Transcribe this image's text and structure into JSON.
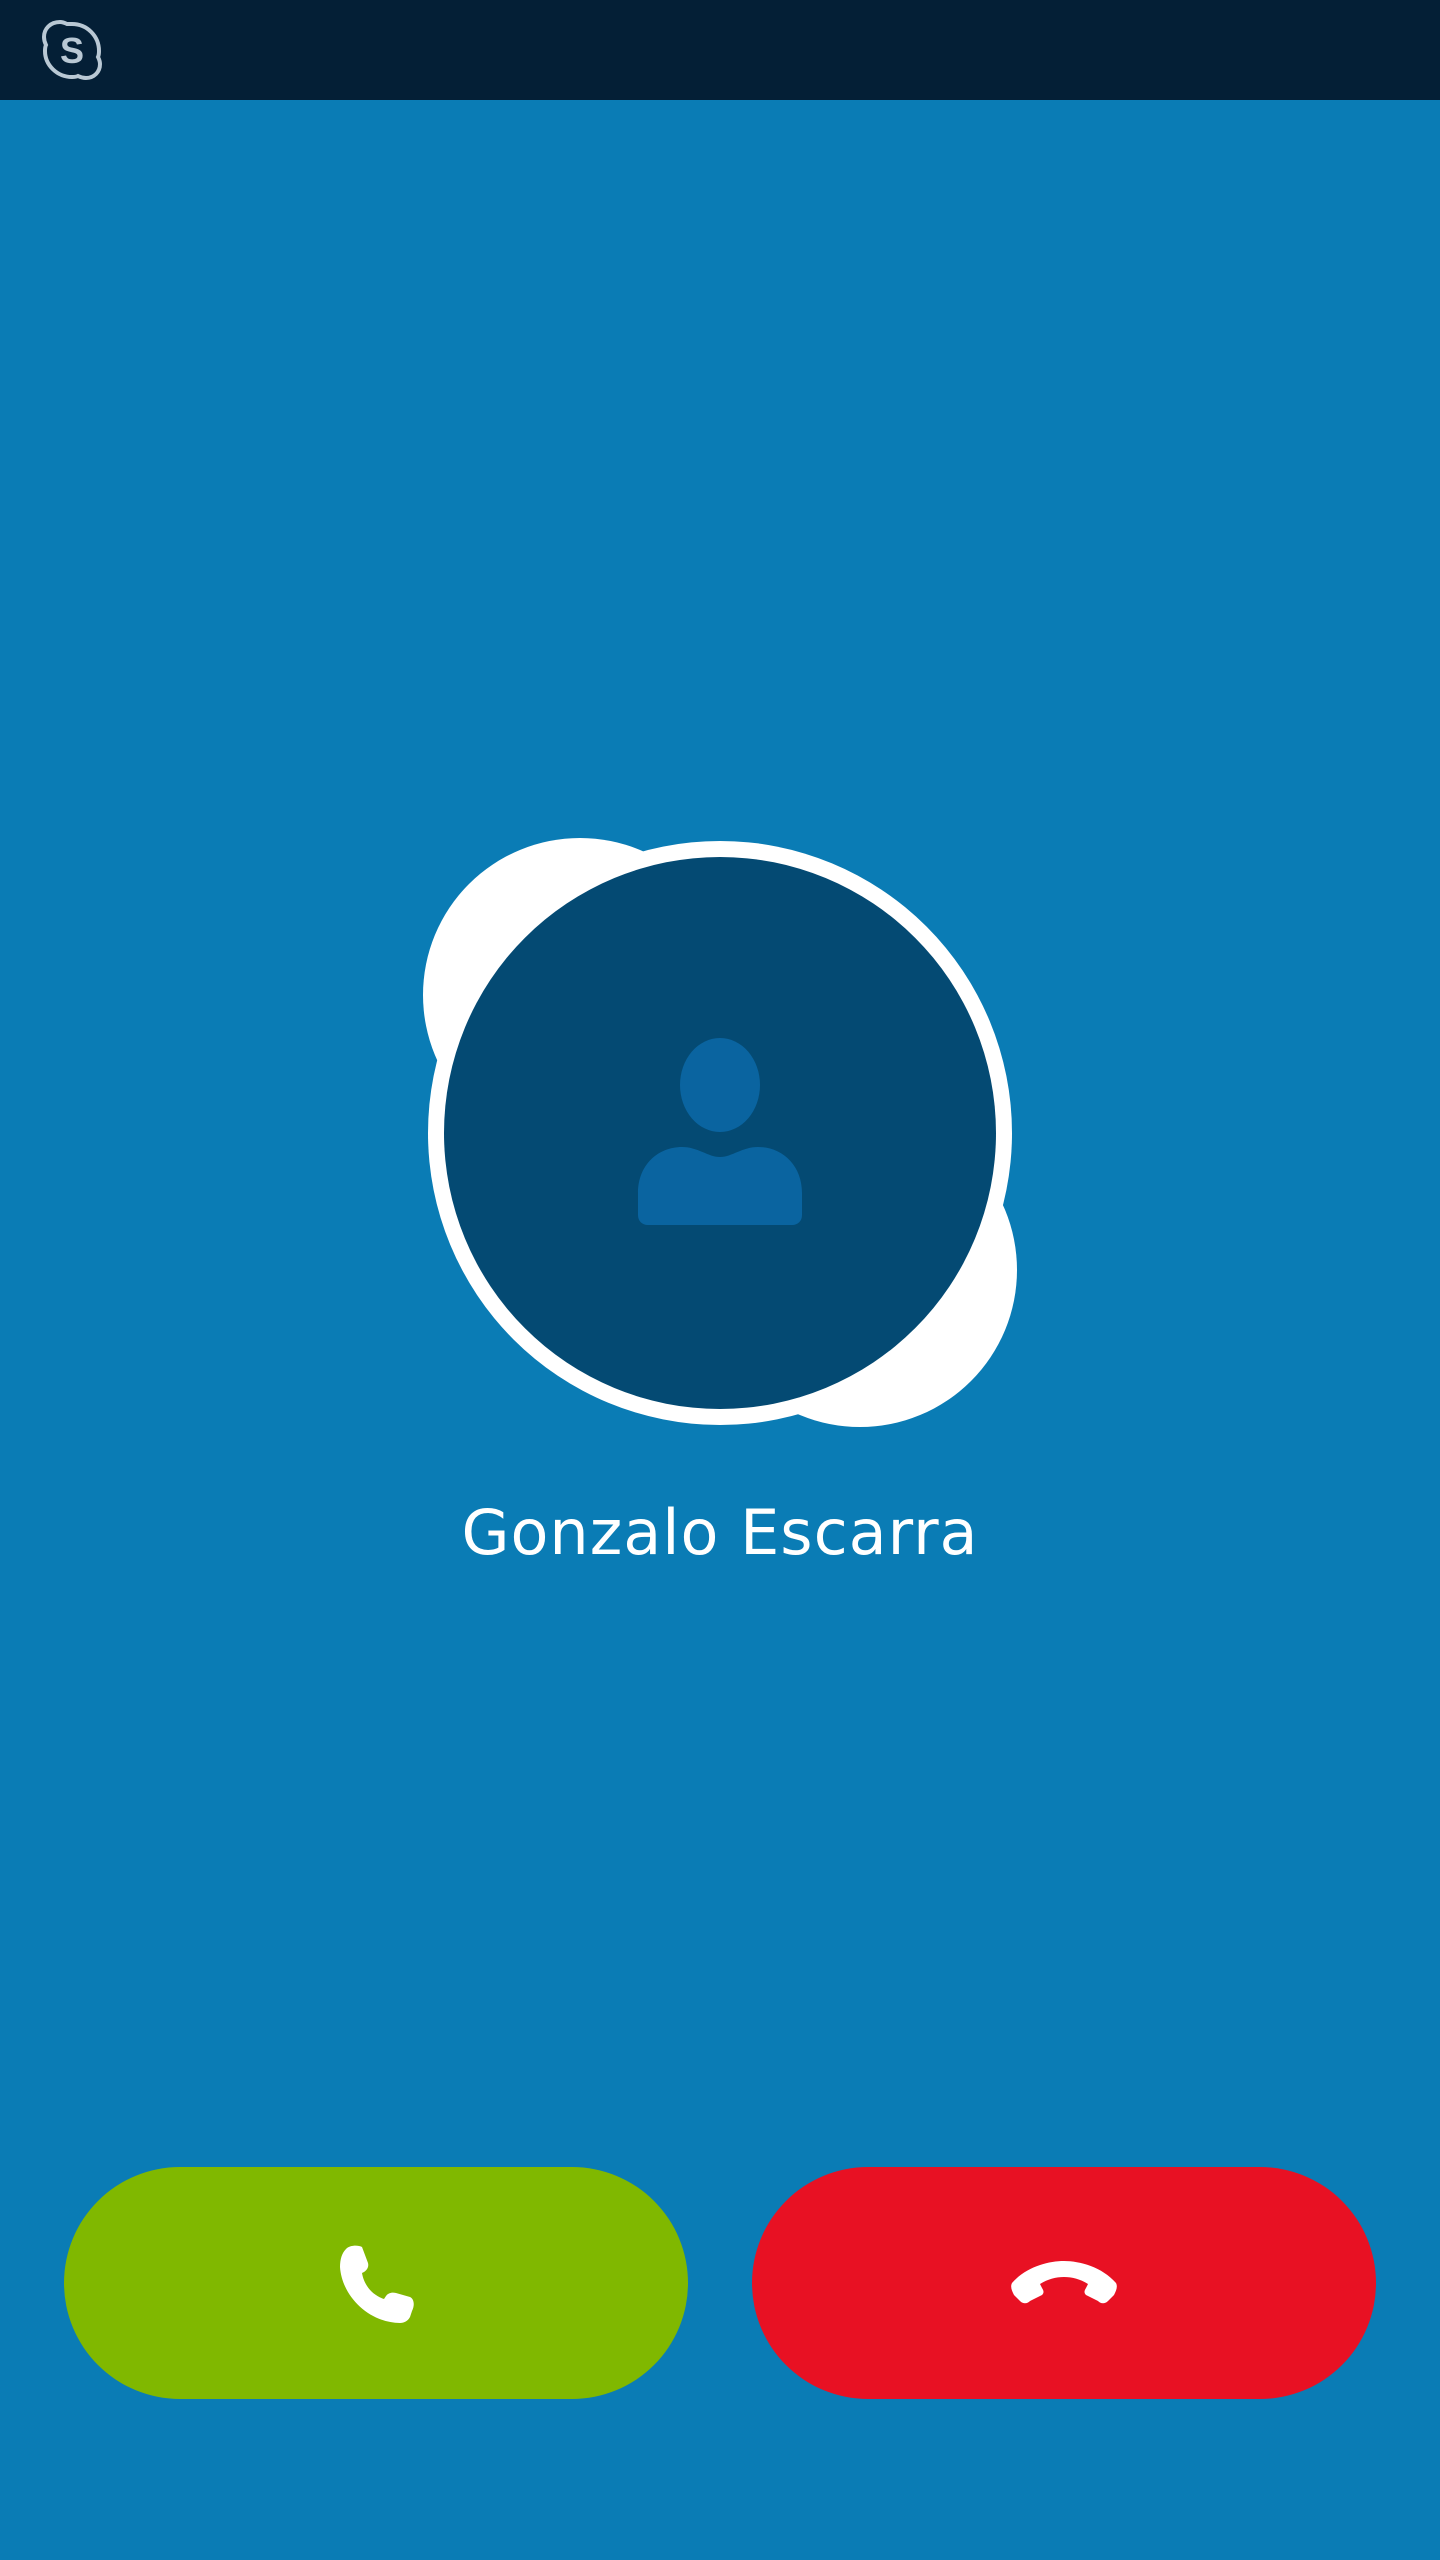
{
  "app": {
    "logo_icon": "skype-logo-icon"
  },
  "caller": {
    "name": "Gonzalo Escarra",
    "avatar_icon": "person-silhouette-icon"
  },
  "actions": {
    "accept_icon": "phone-icon",
    "decline_icon": "hang-up-icon"
  },
  "colors": {
    "status_bar": "#041f36",
    "background": "#0a7cb5",
    "avatar_fill": "#044a73",
    "accept": "#80b800",
    "decline": "#e81123"
  }
}
